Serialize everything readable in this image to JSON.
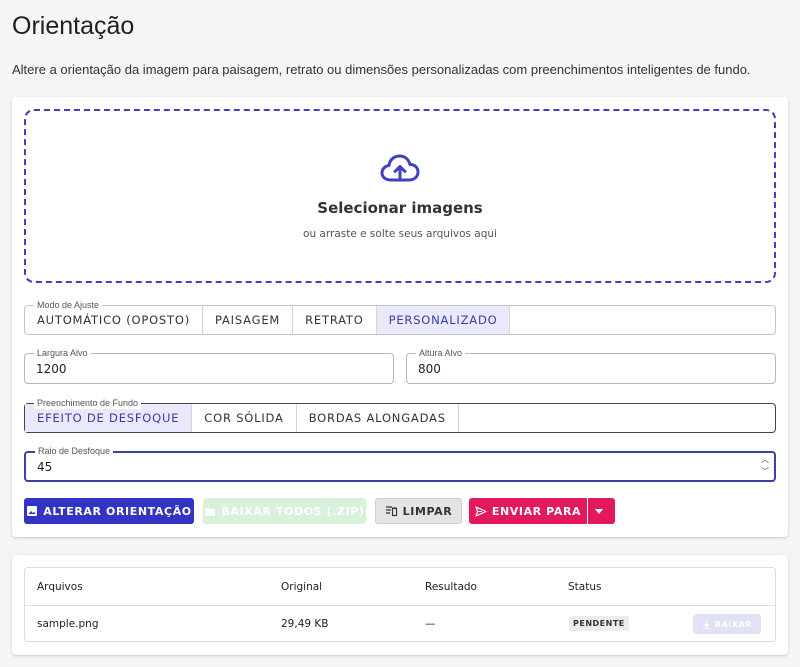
{
  "page": {
    "title": "Orientação",
    "description": "Altere a orientação da imagem para paisagem, retrato ou dimensões personalizadas com preenchimentos inteligentes de fundo."
  },
  "dropzone": {
    "title": "Selecionar imagens",
    "subtitle": "ou arraste e solte seus arquivos aqui",
    "icon": "cloud-upload-icon",
    "accent": "#3f3fc2"
  },
  "fit_mode": {
    "legend": "Modo de Ajuste",
    "options": [
      "AUTOMÁTICO (OPOSTO)",
      "PAISAGEM",
      "RETRATO",
      "PERSONALIZADO"
    ],
    "selected": "PERSONALIZADO"
  },
  "width_field": {
    "label": "Largura Alvo",
    "value": "1200"
  },
  "height_field": {
    "label": "Altura Alvo",
    "value": "800"
  },
  "background_fill": {
    "legend": "Preenchimento de Fundo",
    "options": [
      "EFEITO DE DESFOQUE",
      "COR SÓLIDA",
      "BORDAS ALONGADAS"
    ],
    "selected": "EFEITO DE DESFOQUE"
  },
  "blur_radius": {
    "label": "Raio de Desfoque",
    "value": "45"
  },
  "actions": {
    "change_orientation": "ALTERAR ORIENTAÇÃO",
    "download_all": "BAIXAR TODOS (.ZIP)",
    "clear": "LIMPAR",
    "send_to": "ENVIAR PARA"
  },
  "colors": {
    "primary": "#3333c4",
    "pink": "#e2195f",
    "disabled_green": "#d9f0db"
  },
  "table": {
    "headers": [
      "Arquivos",
      "Original",
      "Resultado",
      "Status"
    ],
    "rows": [
      {
        "file": "sample.png",
        "original": "29,49 KB",
        "result": "—",
        "status": "PENDENTE",
        "action": "BAIXAR"
      }
    ]
  }
}
